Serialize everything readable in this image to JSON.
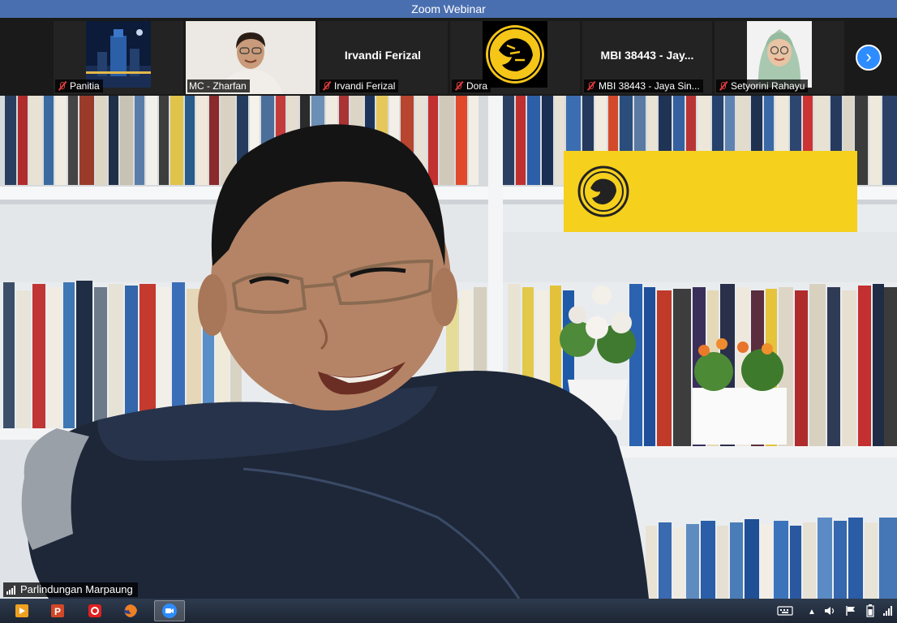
{
  "window": {
    "title": "Zoom Webinar"
  },
  "participants": [
    {
      "name": "Panitia",
      "type": "image"
    },
    {
      "name": "MC - Zharfan",
      "type": "video"
    },
    {
      "name": "Irvandi Ferizal",
      "display_name": "Irvandi Ferizal",
      "type": "text"
    },
    {
      "name": "Dora",
      "type": "image"
    },
    {
      "name": "MBI 38443 - Jaya Sin...",
      "display_name": "MBI 38443 - Jay...",
      "type": "text"
    },
    {
      "name": "Setyorini Rahayu",
      "type": "image"
    }
  ],
  "active_speaker": {
    "name": "Parlindungan Marpaung"
  },
  "background_sign": {
    "brand": "Maybank",
    "color": "#f5d01d"
  },
  "colors": {
    "accent": "#2d8cff",
    "titlebar": "#4a6fb0",
    "muted": "#e03c3c"
  },
  "taskbar": {
    "apps": [
      "media-player-icon",
      "powerpoint-icon",
      "adobe-reader-icon",
      "firefox-icon",
      "zoom-icon"
    ],
    "tray": [
      "keyboard-icon",
      "tray-expand-icon",
      "volume-icon",
      "action-center-flag-icon",
      "battery-icon",
      "network-signal-icon"
    ]
  }
}
